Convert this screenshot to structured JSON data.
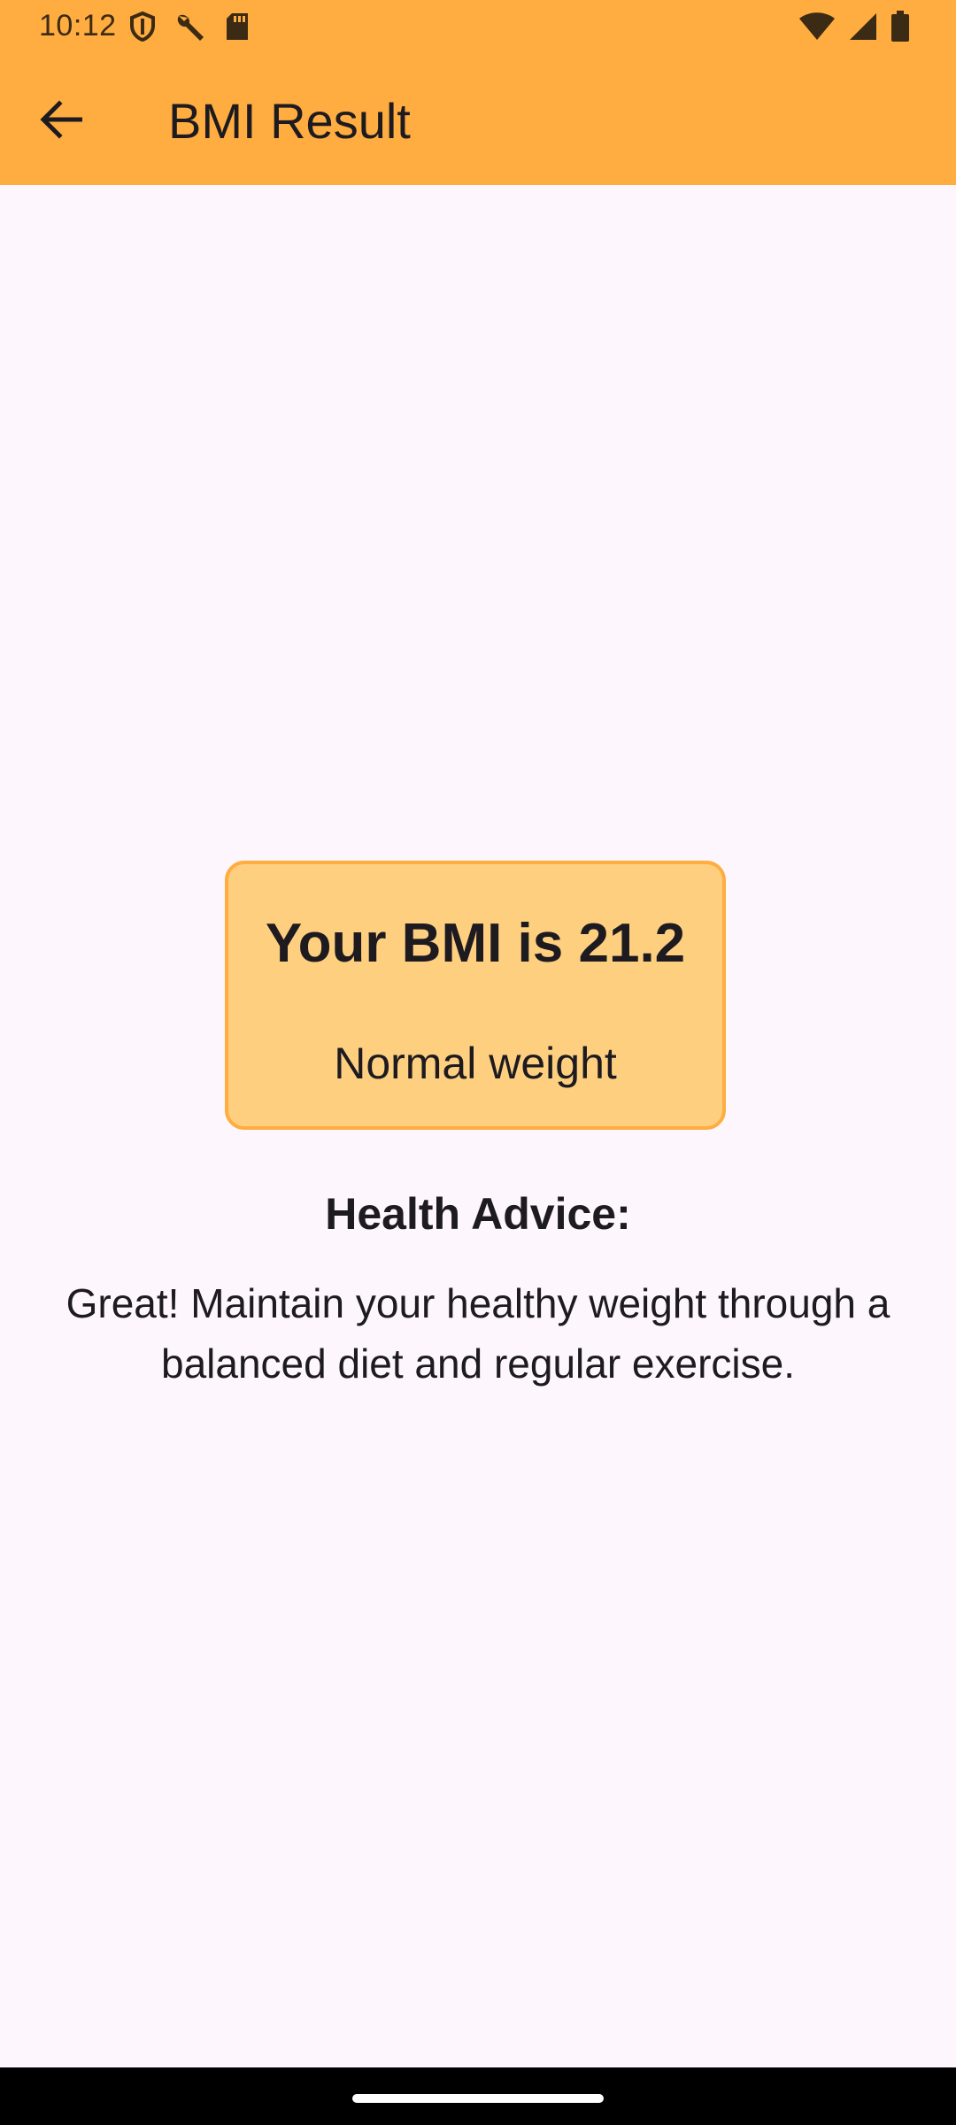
{
  "status_bar": {
    "time": "10:12",
    "left_icons": [
      "shield-icon",
      "wrench-icon",
      "sd-card-icon"
    ],
    "right_icons": [
      "wifi-icon",
      "cell-signal-icon",
      "battery-icon"
    ]
  },
  "app_bar": {
    "title": "BMI Result",
    "back_icon": "arrow-back-icon"
  },
  "result": {
    "bmi_text": "Your BMI is 21.2",
    "category": "Normal weight"
  },
  "advice": {
    "title": "Health Advice:",
    "text": "Great! Maintain your healthy weight through a balanced diet and regular exercise."
  },
  "colors": {
    "primary": "#ffac40",
    "card_fill": "#ffcf80",
    "background": "#fdf6fc",
    "text": "#1d1b20"
  }
}
